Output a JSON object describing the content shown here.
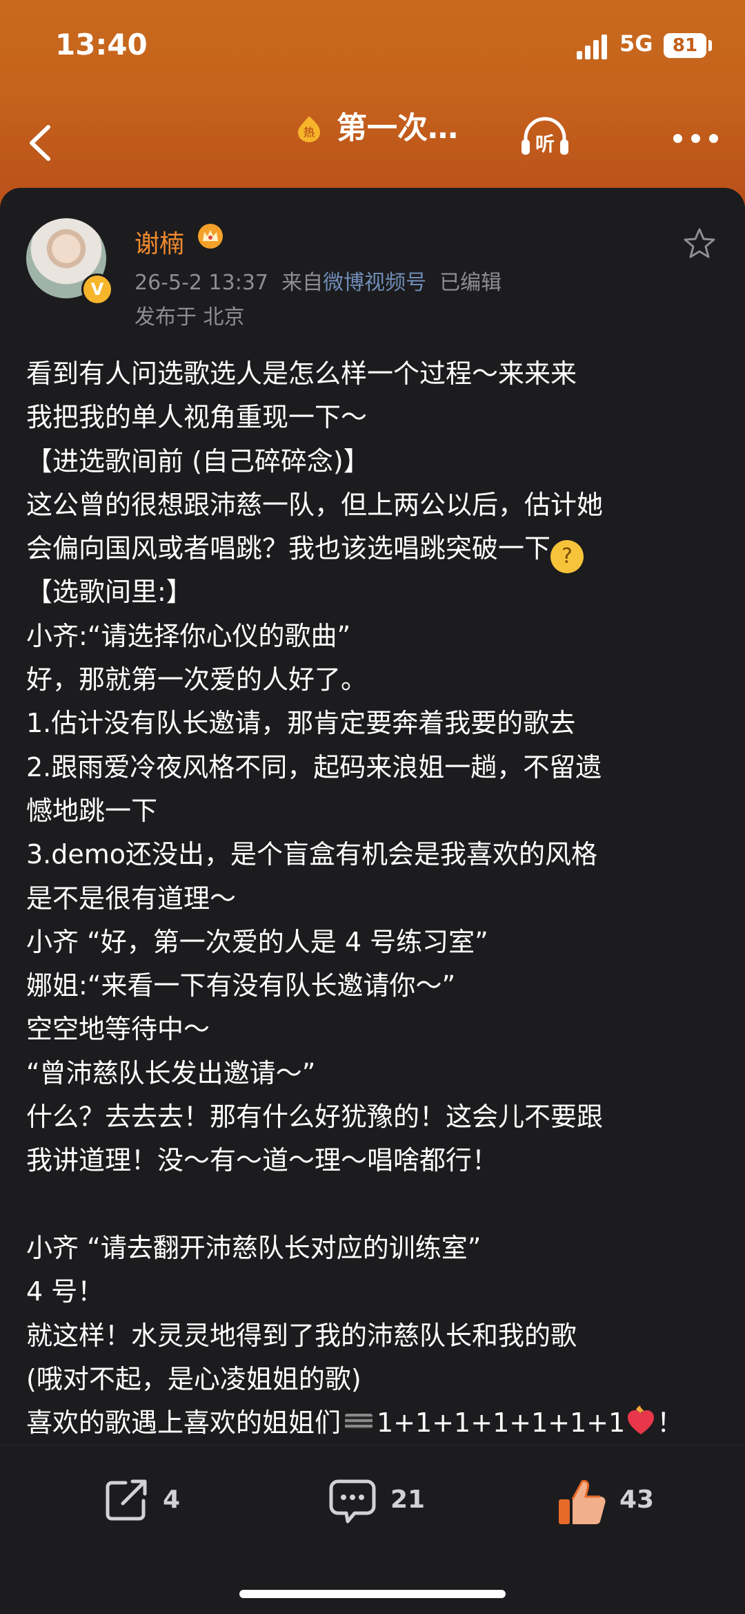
{
  "status_bar": {
    "time": "13:40",
    "network": "5G",
    "battery": "81"
  },
  "nav": {
    "title": "第一次…",
    "hot_badge": "热",
    "listen_label": "听"
  },
  "author": {
    "name": "谢楠",
    "verified_mark": "V",
    "time": "26-5-2 13:37",
    "from_prefix": "来自",
    "source": "微博视频号",
    "edited": "已编辑",
    "location": "发布于 北京"
  },
  "post": {
    "lines": [
      "看到有人问选歌选人是怎么样一个过程～来来来",
      "我把我的单人视角重现一下～",
      "【进选歌间前 (自己碎碎念)】",
      "这公曾的很想跟沛慈一队，但上两公以后，估计她",
      "会偏向国风或者唱跳？我也该选唱跳突破一下",
      "【选歌间里:】",
      "小齐:“请选择你心仪的歌曲”",
      "好，那就第一次爱的人好了。",
      "1.估计没有队长邀请，那肯定要奔着我要的歌去",
      "2.跟雨爱冷夜风格不同，起码来浪姐一趟，不留遗",
      "憾地跳一下",
      "3.demo还没出，是个盲盒有机会是我喜欢的风格",
      "是不是很有道理～",
      "小齐 “好，第一次爱的人是 4 号练习室”",
      "娜姐:“来看一下有没有队长邀请你～”",
      "空空地等待中～",
      "“曾沛慈队长发出邀请～”",
      "什么？去去去！那有什么好犹豫的！这会儿不要跟",
      "我讲道理！没～有～道～理～唱啥都行！",
      "",
      "小齐 “请去翻开沛慈队长对应的训练室”",
      "4 号！",
      "就这样！水灵灵地得到了我的沛慈队长和我的歌",
      "(哦对不起，是心凌姐姐的歌)",
      "喜欢的歌遇上喜欢的姐姐们"
    ],
    "last_line_suffix": "1+1+1+1+1+1+1",
    "last_line_end": "！"
  },
  "actions": {
    "repost_count": "4",
    "comment_count": "21",
    "like_count": "43"
  }
}
